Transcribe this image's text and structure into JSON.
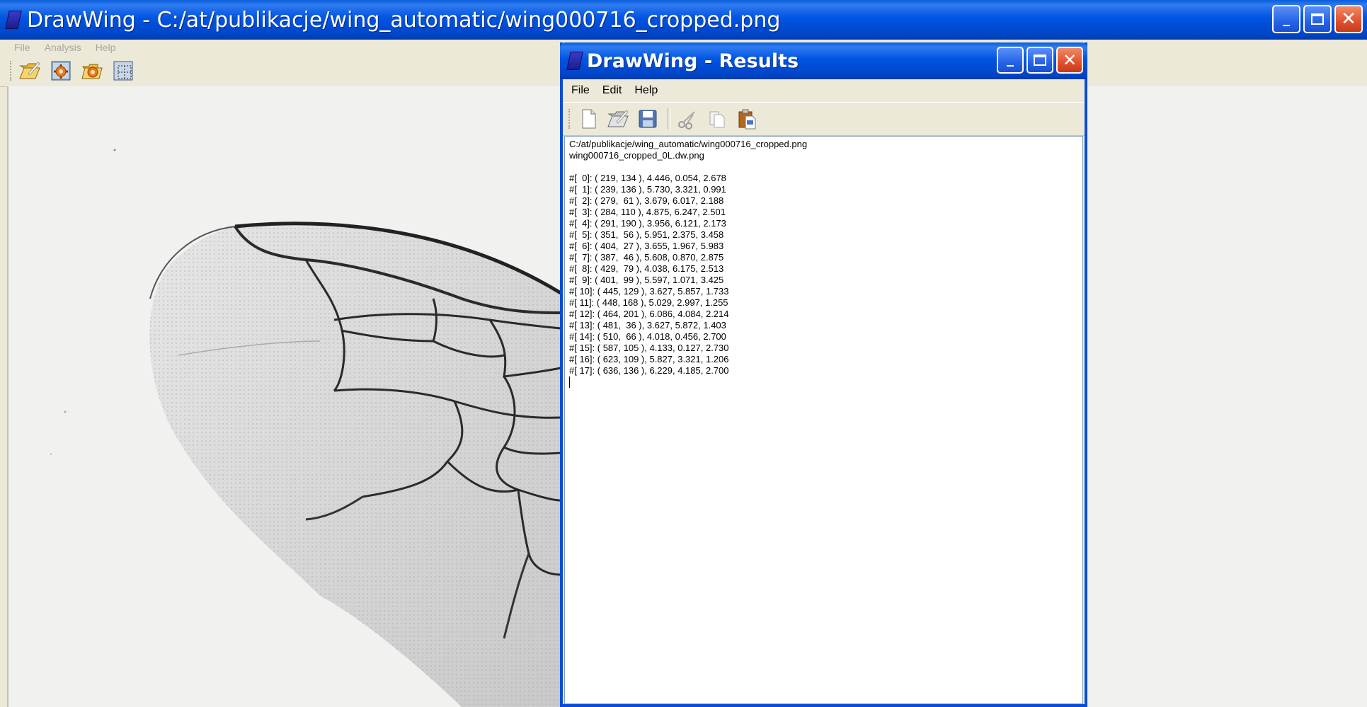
{
  "main_window": {
    "title": "DrawWing - C:/at/publikacje/wing_automatic/wing000716_cropped.png",
    "menu": [
      "File",
      "Analysis",
      "Help"
    ],
    "toolbar_icons": [
      "open-icon",
      "gear-icon",
      "gear-folder-icon",
      "select-region-icon"
    ]
  },
  "results_window": {
    "title": "DrawWing - Results",
    "menu": [
      "File",
      "Edit",
      "Help"
    ],
    "toolbar_icons": [
      "new-file-icon",
      "open-folder-icon",
      "save-icon",
      "cut-icon",
      "copy-icon",
      "paste-icon"
    ],
    "source_path": "C:/at/publikacje/wing_automatic/wing000716_cropped.png",
    "output_file": "wing000716_cropped_0L.dw.png",
    "landmarks": [
      "#[  0]: ( 219, 134 ), 4.446, 0.054, 2.678",
      "#[  1]: ( 239, 136 ), 5.730, 3.321, 0.991",
      "#[  2]: ( 279,  61 ), 3.679, 6.017, 2.188",
      "#[  3]: ( 284, 110 ), 4.875, 6.247, 2.501",
      "#[  4]: ( 291, 190 ), 3.956, 6.121, 2.173",
      "#[  5]: ( 351,  56 ), 5.951, 2.375, 3.458",
      "#[  6]: ( 404,  27 ), 3.655, 1.967, 5.983",
      "#[  7]: ( 387,  46 ), 5.608, 0.870, 2.875",
      "#[  8]: ( 429,  79 ), 4.038, 6.175, 2.513",
      "#[  9]: ( 401,  99 ), 5.597, 1.071, 3.425",
      "#[ 10]: ( 445, 129 ), 3.627, 5.857, 1.733",
      "#[ 11]: ( 448, 168 ), 5.029, 2.997, 1.255",
      "#[ 12]: ( 464, 201 ), 6.086, 4.084, 2.214",
      "#[ 13]: ( 481,  36 ), 3.627, 5.872, 1.403",
      "#[ 14]: ( 510,  66 ), 4.018, 0.456, 2.700",
      "#[ 15]: ( 587, 105 ), 4.133, 0.127, 2.730",
      "#[ 16]: ( 623, 109 ), 5.827, 3.321, 1.206",
      "#[ 17]: ( 636, 136 ), 6.229, 4.185, 2.700"
    ]
  },
  "colors": {
    "titlebar": "#0054e3",
    "window_bg": "#ece9d8",
    "close_button": "#e0512e"
  }
}
